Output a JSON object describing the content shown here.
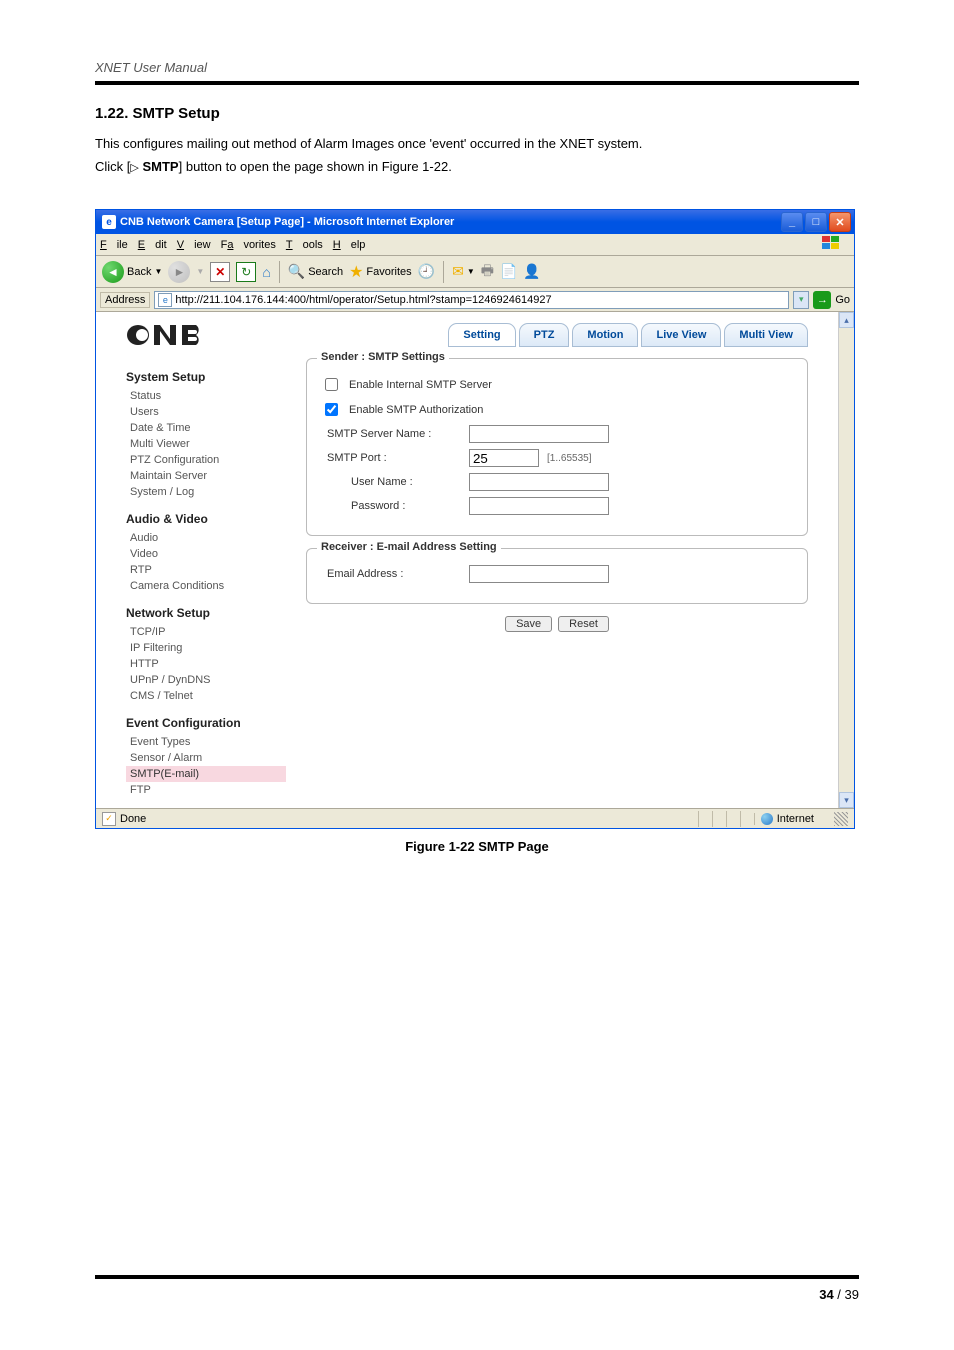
{
  "doc_header": "XNET User Manual",
  "section": {
    "title": "1.22. SMTP Setup",
    "line1": "This configures mailing out method of Alarm Images once 'event' occurred in the XNET system.",
    "line2_pre": "Click [",
    "line2_button": "SMTP",
    "line2_post": "] button to open the page shown in Figure 1-22."
  },
  "ie": {
    "title": "CNB Network Camera [Setup Page] - Microsoft Internet Explorer",
    "menus": {
      "file": "File",
      "edit": "Edit",
      "view": "View",
      "favorites": "Favorites",
      "tools": "Tools",
      "help": "Help"
    },
    "toolbar": {
      "back": "Back",
      "search": "Search",
      "favorites": "Favorites"
    },
    "address_label": "Address",
    "address_url": "http://211.104.176.144:400/html/operator/Setup.html?stamp=1246924614927",
    "go": "Go",
    "status_done": "Done",
    "status_zone": "Internet"
  },
  "page": {
    "logo": "CNB",
    "tabs": {
      "setting": "Setting",
      "ptz": "PTZ",
      "motion": "Motion",
      "live": "Live View",
      "multi": "Multi View"
    },
    "sidebar": {
      "g1": "System Setup",
      "g1_items": [
        "Status",
        "Users",
        "Date & Time",
        "Multi Viewer",
        "PTZ Configuration",
        "Maintain Server",
        "System / Log"
      ],
      "g2": "Audio & Video",
      "g2_items": [
        "Audio",
        "Video",
        "RTP",
        "Camera Conditions"
      ],
      "g3": "Network Setup",
      "g3_items": [
        "TCP/IP",
        "IP Filtering",
        "HTTP",
        "UPnP / DynDNS",
        "CMS / Telnet"
      ],
      "g4": "Event Configuration",
      "g4_items": [
        "Event Types",
        "Sensor / Alarm",
        "SMTP(E-mail)",
        "FTP"
      ]
    },
    "form": {
      "sender_legend": "Sender : SMTP Settings",
      "receiver_legend": "Receiver : E-mail Address Setting",
      "chk_internal": "Enable Internal SMTP Server",
      "chk_auth": "Enable SMTP Authorization",
      "server_lbl": "SMTP Server Name :",
      "port_lbl": "SMTP Port :",
      "port_val": "25",
      "port_range": "[1..65535]",
      "user_lbl": "User Name :",
      "pass_lbl": "Password :",
      "email_lbl": "Email Address :",
      "save": "Save",
      "reset": "Reset"
    }
  },
  "caption": "Figure 1-22 SMTP Page",
  "pagenum": {
    "current": "34",
    "sep": " / ",
    "total": "39"
  }
}
